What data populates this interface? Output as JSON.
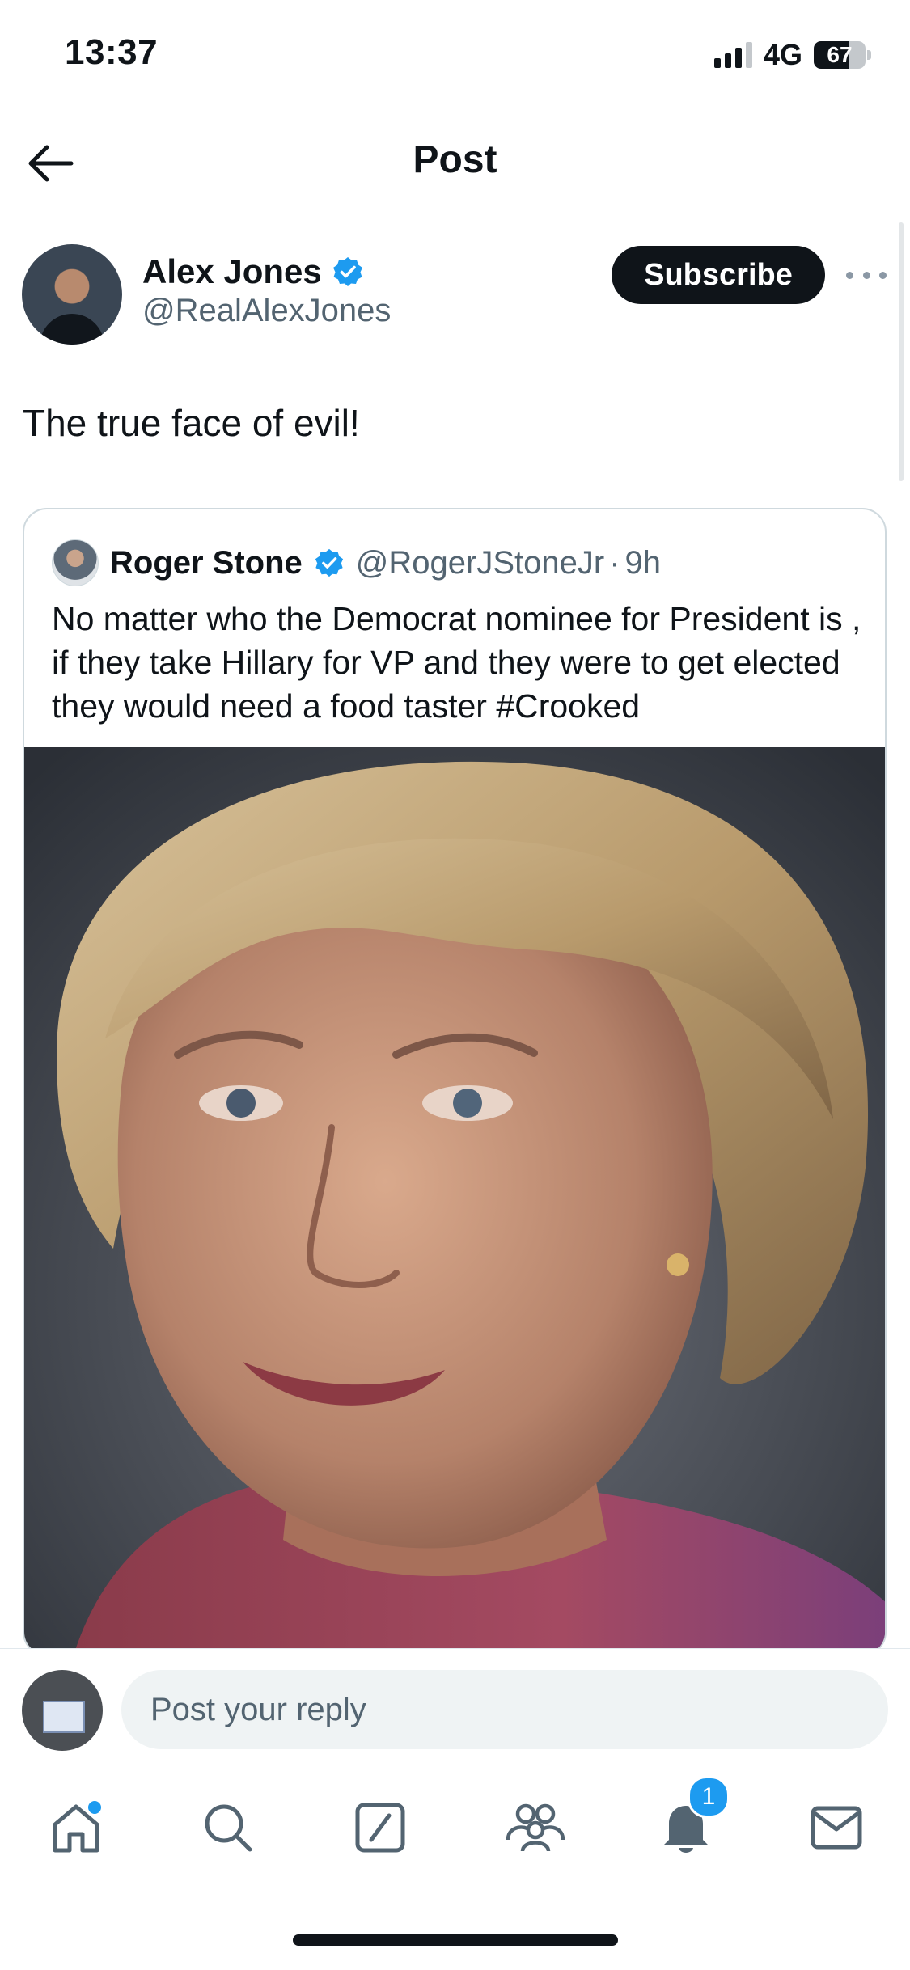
{
  "status_bar": {
    "time": "13:37",
    "network": "4G",
    "battery": "67",
    "battery_level_percent": 67
  },
  "header": {
    "title": "Post",
    "back_icon": "arrow-left-icon"
  },
  "post": {
    "author_name": "Alex Jones",
    "author_handle": "@RealAlexJones",
    "verified": true,
    "subscribe_label": "Subscribe",
    "text": "The true face of evil!"
  },
  "quoted_post": {
    "author_name": "Roger Stone",
    "author_handle": "@RogerJStoneJr",
    "separator": "·",
    "time": "9h",
    "text": "No matter who the Democrat nominee for President is , if they take Hillary for VP and they were to get elected they would need a food  taster #Crooked"
  },
  "reply": {
    "placeholder": "Post your reply"
  },
  "tab_bar": {
    "tabs": [
      {
        "icon": "home-icon"
      },
      {
        "icon": "search-icon"
      },
      {
        "icon": "grok-icon"
      },
      {
        "icon": "communities-icon"
      },
      {
        "icon": "notifications-icon"
      },
      {
        "icon": "messages-icon"
      }
    ],
    "notifications_badge": "1"
  },
  "colors": {
    "accent": "#1d9bf0",
    "text": "#0f1419",
    "secondary_text": "#536471",
    "border": "#cfd9de"
  }
}
